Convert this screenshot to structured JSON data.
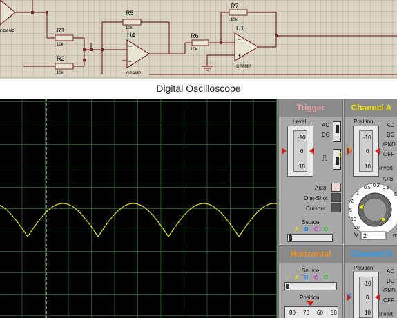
{
  "window": {
    "title": "Digital Oscilloscope"
  },
  "schematic": {
    "components": [
      {
        "ref": "R1",
        "value": "10k"
      },
      {
        "ref": "R2",
        "value": "10k"
      },
      {
        "ref": "R5",
        "value": "10k"
      },
      {
        "ref": "R6",
        "value": "10k"
      },
      {
        "ref": "R7",
        "value": "10k"
      },
      {
        "ref": "U4",
        "value": "OPAMP"
      },
      {
        "ref": "U1",
        "value": "OPAMP"
      }
    ],
    "partial_label": "OPAMP"
  },
  "trace": {
    "color": "#e6e600",
    "shape": "full-wave rectified sine",
    "cycles_visible": 4
  },
  "trigger": {
    "heading": "Trigger",
    "level_label": "Level",
    "ticks": [
      "-10",
      "0",
      "10"
    ],
    "coupling": [
      "AC",
      "DC"
    ],
    "modes": [
      "Auto",
      "One-Shot",
      "Cursors"
    ],
    "source_label": "Source",
    "sources": [
      "A",
      "B",
      "C",
      "D"
    ]
  },
  "channel_a": {
    "heading": "Channel A",
    "position_label": "Position",
    "ticks": [
      "-10",
      "0",
      "10"
    ],
    "coupling": [
      "AC",
      "DC",
      "GND",
      "OFF"
    ],
    "invert_label": "Invert",
    "aplusb_label": "A+B",
    "dial_values": [
      "0.5",
      "0.2",
      "0.1",
      "1",
      "2",
      "5",
      "10",
      "20"
    ],
    "dial_right": [
      "50",
      "2"
    ],
    "unit_left": "V",
    "entry_value": "2",
    "unit_right": "m"
  },
  "horizontal": {
    "heading": "Horizontal",
    "source_label": "Source",
    "sources": [
      "A",
      "B",
      "C",
      "D"
    ],
    "position_label": "Position",
    "scale": [
      "80",
      "70",
      "60",
      "50"
    ]
  },
  "channel_b": {
    "heading": "Channel B",
    "position_label": "Position",
    "ticks": [
      "-10",
      "0",
      "10"
    ],
    "coupling": [
      "AC",
      "DC",
      "GND",
      "OFF"
    ],
    "invert_label": "Invert"
  },
  "colors": {
    "trigger_heading": "#e8a0a0",
    "channel_a_heading": "#f0e000",
    "horizontal_heading": "#f09020",
    "channel_b_heading": "#20a0ff",
    "source_a": "#e6e600",
    "source_b": "#1e90ff",
    "source_c": "#e020e0",
    "source_d": "#20c020"
  }
}
